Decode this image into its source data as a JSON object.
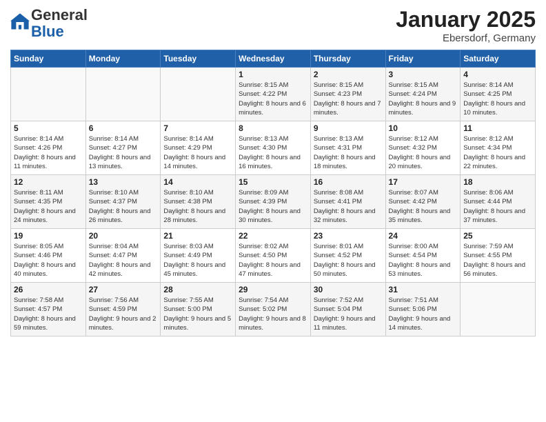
{
  "header": {
    "logo_general": "General",
    "logo_blue": "Blue",
    "month_title": "January 2025",
    "location": "Ebersdorf, Germany"
  },
  "weekdays": [
    "Sunday",
    "Monday",
    "Tuesday",
    "Wednesday",
    "Thursday",
    "Friday",
    "Saturday"
  ],
  "weeks": [
    [
      {
        "day": "",
        "info": ""
      },
      {
        "day": "",
        "info": ""
      },
      {
        "day": "",
        "info": ""
      },
      {
        "day": "1",
        "info": "Sunrise: 8:15 AM\nSunset: 4:22 PM\nDaylight: 8 hours and 6 minutes."
      },
      {
        "day": "2",
        "info": "Sunrise: 8:15 AM\nSunset: 4:23 PM\nDaylight: 8 hours and 7 minutes."
      },
      {
        "day": "3",
        "info": "Sunrise: 8:15 AM\nSunset: 4:24 PM\nDaylight: 8 hours and 9 minutes."
      },
      {
        "day": "4",
        "info": "Sunrise: 8:14 AM\nSunset: 4:25 PM\nDaylight: 8 hours and 10 minutes."
      }
    ],
    [
      {
        "day": "5",
        "info": "Sunrise: 8:14 AM\nSunset: 4:26 PM\nDaylight: 8 hours and 11 minutes."
      },
      {
        "day": "6",
        "info": "Sunrise: 8:14 AM\nSunset: 4:27 PM\nDaylight: 8 hours and 13 minutes."
      },
      {
        "day": "7",
        "info": "Sunrise: 8:14 AM\nSunset: 4:29 PM\nDaylight: 8 hours and 14 minutes."
      },
      {
        "day": "8",
        "info": "Sunrise: 8:13 AM\nSunset: 4:30 PM\nDaylight: 8 hours and 16 minutes."
      },
      {
        "day": "9",
        "info": "Sunrise: 8:13 AM\nSunset: 4:31 PM\nDaylight: 8 hours and 18 minutes."
      },
      {
        "day": "10",
        "info": "Sunrise: 8:12 AM\nSunset: 4:32 PM\nDaylight: 8 hours and 20 minutes."
      },
      {
        "day": "11",
        "info": "Sunrise: 8:12 AM\nSunset: 4:34 PM\nDaylight: 8 hours and 22 minutes."
      }
    ],
    [
      {
        "day": "12",
        "info": "Sunrise: 8:11 AM\nSunset: 4:35 PM\nDaylight: 8 hours and 24 minutes."
      },
      {
        "day": "13",
        "info": "Sunrise: 8:10 AM\nSunset: 4:37 PM\nDaylight: 8 hours and 26 minutes."
      },
      {
        "day": "14",
        "info": "Sunrise: 8:10 AM\nSunset: 4:38 PM\nDaylight: 8 hours and 28 minutes."
      },
      {
        "day": "15",
        "info": "Sunrise: 8:09 AM\nSunset: 4:39 PM\nDaylight: 8 hours and 30 minutes."
      },
      {
        "day": "16",
        "info": "Sunrise: 8:08 AM\nSunset: 4:41 PM\nDaylight: 8 hours and 32 minutes."
      },
      {
        "day": "17",
        "info": "Sunrise: 8:07 AM\nSunset: 4:42 PM\nDaylight: 8 hours and 35 minutes."
      },
      {
        "day": "18",
        "info": "Sunrise: 8:06 AM\nSunset: 4:44 PM\nDaylight: 8 hours and 37 minutes."
      }
    ],
    [
      {
        "day": "19",
        "info": "Sunrise: 8:05 AM\nSunset: 4:46 PM\nDaylight: 8 hours and 40 minutes."
      },
      {
        "day": "20",
        "info": "Sunrise: 8:04 AM\nSunset: 4:47 PM\nDaylight: 8 hours and 42 minutes."
      },
      {
        "day": "21",
        "info": "Sunrise: 8:03 AM\nSunset: 4:49 PM\nDaylight: 8 hours and 45 minutes."
      },
      {
        "day": "22",
        "info": "Sunrise: 8:02 AM\nSunset: 4:50 PM\nDaylight: 8 hours and 47 minutes."
      },
      {
        "day": "23",
        "info": "Sunrise: 8:01 AM\nSunset: 4:52 PM\nDaylight: 8 hours and 50 minutes."
      },
      {
        "day": "24",
        "info": "Sunrise: 8:00 AM\nSunset: 4:54 PM\nDaylight: 8 hours and 53 minutes."
      },
      {
        "day": "25",
        "info": "Sunrise: 7:59 AM\nSunset: 4:55 PM\nDaylight: 8 hours and 56 minutes."
      }
    ],
    [
      {
        "day": "26",
        "info": "Sunrise: 7:58 AM\nSunset: 4:57 PM\nDaylight: 8 hours and 59 minutes."
      },
      {
        "day": "27",
        "info": "Sunrise: 7:56 AM\nSunset: 4:59 PM\nDaylight: 9 hours and 2 minutes."
      },
      {
        "day": "28",
        "info": "Sunrise: 7:55 AM\nSunset: 5:00 PM\nDaylight: 9 hours and 5 minutes."
      },
      {
        "day": "29",
        "info": "Sunrise: 7:54 AM\nSunset: 5:02 PM\nDaylight: 9 hours and 8 minutes."
      },
      {
        "day": "30",
        "info": "Sunrise: 7:52 AM\nSunset: 5:04 PM\nDaylight: 9 hours and 11 minutes."
      },
      {
        "day": "31",
        "info": "Sunrise: 7:51 AM\nSunset: 5:06 PM\nDaylight: 9 hours and 14 minutes."
      },
      {
        "day": "",
        "info": ""
      }
    ]
  ]
}
